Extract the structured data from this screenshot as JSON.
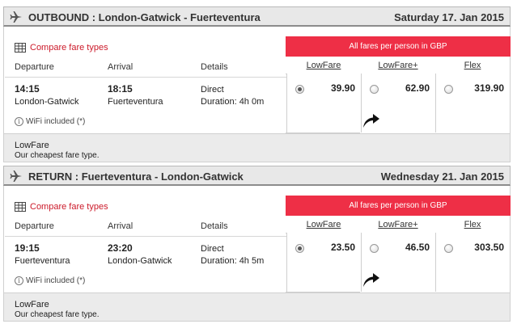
{
  "outbound": {
    "title": "OUTBOUND :  London-Gatwick - Fuerteventura",
    "date": "Saturday 17. Jan 2015",
    "compare_label": "Compare fare types",
    "banner": "All fares per person in GBP",
    "col_departure": "Departure",
    "col_arrival": "Arrival",
    "col_details": "Details",
    "dep_time": "14:15",
    "dep_place": "London-Gatwick",
    "arr_time": "18:15",
    "arr_place": "Fuerteventura",
    "details_type": "Direct",
    "details_duration": "Duration: 4h 0m",
    "wifi": "WiFi included (*)",
    "fares": [
      {
        "name": "LowFare",
        "price": "39.90",
        "selected": true
      },
      {
        "name": "LowFare+",
        "price": "62.90",
        "selected": false
      },
      {
        "name": "Flex",
        "price": "319.90",
        "selected": false
      }
    ],
    "fare_note_name": "LowFare",
    "fare_note_desc": "Our cheapest fare type."
  },
  "return": {
    "title": "RETURN :  Fuerteventura - London-Gatwick",
    "date": "Wednesday 21. Jan 2015",
    "compare_label": "Compare fare types",
    "banner": "All fares per person in GBP",
    "col_departure": "Departure",
    "col_arrival": "Arrival",
    "col_details": "Details",
    "dep_time": "19:15",
    "dep_place": "Fuerteventura",
    "arr_time": "23:20",
    "arr_place": "London-Gatwick",
    "details_type": "Direct",
    "details_duration": "Duration: 4h 5m",
    "wifi": "WiFi included (*)",
    "fares": [
      {
        "name": "LowFare",
        "price": "23.50",
        "selected": true
      },
      {
        "name": "LowFare+",
        "price": "46.50",
        "selected": false
      },
      {
        "name": "Flex",
        "price": "303.50",
        "selected": false
      }
    ],
    "fare_note_name": "LowFare",
    "fare_note_desc": "Our cheapest fare type."
  },
  "colors": {
    "banner": "#ee2f46",
    "link": "#cc1a2a"
  },
  "icons": [
    "plane-icon",
    "table-icon",
    "info-icon",
    "curved-arrow-icon"
  ]
}
